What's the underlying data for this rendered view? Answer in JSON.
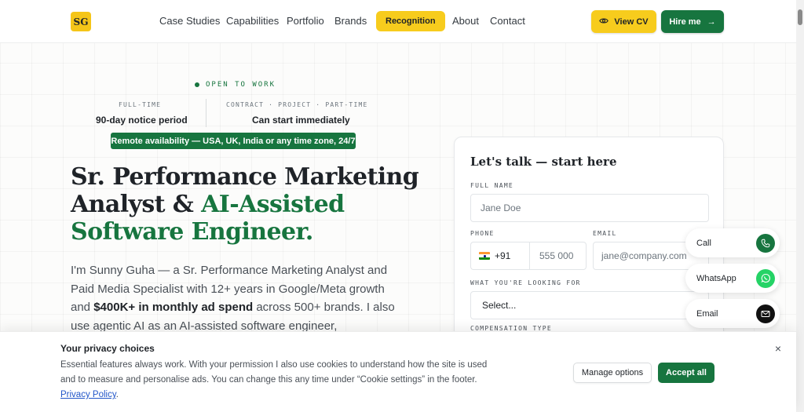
{
  "header": {
    "logo": "SG",
    "nav": [
      "Case Studies",
      "Capabilities",
      "Portfolio",
      "Brands",
      "Recognition",
      "About",
      "Contact"
    ],
    "view_cv": "View CV",
    "hire_me": "Hire me",
    "hire_arrow": "→"
  },
  "hero": {
    "status": "OPEN TO WORK",
    "availability": [
      {
        "label": "FULL-TIME",
        "value": "90-day notice period"
      },
      {
        "label": "CONTRACT · PROJECT · PART-TIME",
        "value": "Can start immediately"
      }
    ],
    "remote": "Remote availability — USA, UK, India or any time zone, 24/7",
    "title_line1": "Sr. Performance Marketing",
    "title_line2_a": "Analyst & ",
    "title_line2_b": "AI-Assisted",
    "title_line3": "Software Engineer.",
    "text_part1": "I'm Sunny Guha — a Sr. Performance Marketing Analyst and Paid Media Specialist with 12+ years in Google/Meta growth and ",
    "text_bold": "$400K+ in monthly ad spend",
    "text_part2": " across 500+ brands. I also use agentic AI as an AI-assisted software engineer,"
  },
  "form": {
    "title": "Let's talk — start here",
    "full_name_label": "FULL NAME",
    "full_name_placeholder": "Jane Doe",
    "phone_label": "PHONE",
    "phone_code": "+91",
    "phone_placeholder": "555 000",
    "email_label": "EMAIL",
    "email_placeholder": "jane@company.com",
    "looking_label": "WHAT YOU'RE LOOKING FOR",
    "looking_value": "Select...",
    "comp_label": "COMPENSATION TYPE"
  },
  "contact_float": {
    "call": "Call",
    "whatsapp": "WhatsApp",
    "email": "Email"
  },
  "cookie": {
    "title": "Your privacy choices",
    "text": "Essential features always work. With your permission I also use cookies to understand how the site is used and to measure and personalise ads. You can change this any time under “Cookie settings” in the footer. ",
    "link": "Privacy Policy",
    "link_suffix": ".",
    "manage": "Manage options",
    "accept": "Accept all",
    "close": "×"
  },
  "colors": {
    "accent_green": "#17753f",
    "accent_yellow": "#f7cc1d",
    "whatsapp_green": "#25d366",
    "link_blue": "#2256c9"
  },
  "icons": [
    "eye-icon",
    "arrow-right-icon",
    "phone-icon",
    "whatsapp-icon",
    "mail-icon",
    "close-icon",
    "india-flag-icon"
  ]
}
